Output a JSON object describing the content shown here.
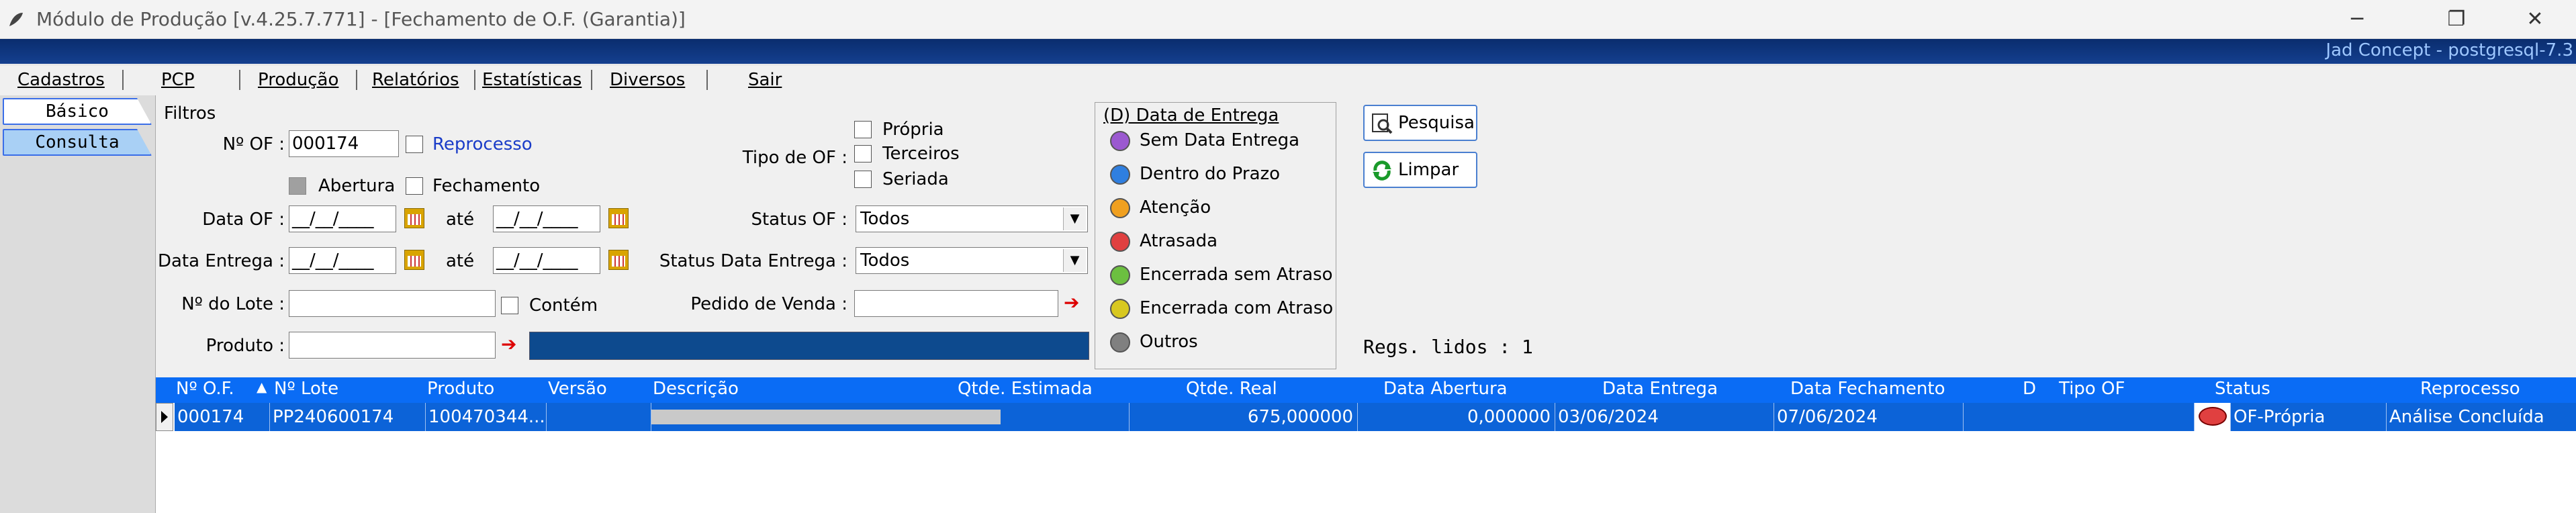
{
  "window": {
    "title": "Módulo de Produção [v.4.25.7.771]  - [Fechamento de O.F. (Garantia)]",
    "connection": "Jad Concept - postgresql-7.3",
    "minimize_icon": "minimize-icon",
    "maximize_icon": "restore-icon",
    "close_icon": "close-icon"
  },
  "menu": [
    "Cadastros",
    "PCP",
    "Produção",
    "Relatórios",
    "Estatísticas",
    "Diversos",
    "Sair"
  ],
  "tabs": {
    "basico": "Básico",
    "consulta": "Consulta"
  },
  "filters": {
    "group_label": "Filtros",
    "num_of_label": "Nº OF :",
    "num_of_value": "000174",
    "reprocesso_label": "Reprocesso",
    "abertura_label": "Abertura",
    "fechamento_label": "Fechamento",
    "data_of_label": "Data OF :",
    "date_mask": "__/__/____",
    "ate_label": "até",
    "data_entrega_label": "Data Entrega :",
    "lote_label": "Nº do Lote :",
    "lote_value": "",
    "contem_label": "Contém",
    "produto_label": "Produto :",
    "produto_value": "",
    "tipo_of_label": "Tipo de OF :",
    "tipo_options": [
      "Própria",
      "Terceiros",
      "Seriada"
    ],
    "status_of_label": "Status OF :",
    "status_of_value": "Todos",
    "status_data_entrega_label": "Status Data Entrega :",
    "status_data_entrega_value": "Todos",
    "pedido_venda_label": "Pedido de Venda :",
    "pedido_venda_value": ""
  },
  "legend": {
    "title": "(D) Data de Entrega",
    "items": [
      {
        "label": "Sem Data Entrega",
        "color": "#9b59d0"
      },
      {
        "label": "Dentro do Prazo",
        "color": "#2f7fe0"
      },
      {
        "label": "Atenção",
        "color": "#f0a020"
      },
      {
        "label": "Atrasada",
        "color": "#e04040"
      },
      {
        "label": "Encerrada sem Atraso",
        "color": "#6cc040"
      },
      {
        "label": "Encerrada com Atraso",
        "color": "#d8c820"
      },
      {
        "label": "Outros",
        "color": "#808080"
      }
    ]
  },
  "buttons": {
    "pesquisa": "Pesquisa",
    "limpar": "Limpar"
  },
  "regs": "Regs. lidos : 1",
  "grid": {
    "columns": [
      "Nº O.F.",
      "Nº Lote",
      "Produto",
      "Versão",
      "Descrição",
      "Qtde. Estimada",
      "Qtde. Real",
      "Data Abertura",
      "Data Entrega",
      "Data Fechamento",
      "D",
      "Tipo OF",
      "Status",
      "Reprocesso"
    ],
    "sort_icon": "sort-ascending-icon",
    "rows": [
      {
        "of": "000174",
        "lote": "PP240600174",
        "produto": "100470344...",
        "versao": "",
        "descricao": "",
        "qtde_estimada": "675,000000",
        "qtde_real": "0,000000",
        "data_abertura": "03/06/2024",
        "data_entrega": "07/06/2024",
        "data_fechamento": "",
        "d_color": "#e04040",
        "tipo_of": "OF-Própria",
        "status": "Análise Concluída",
        "reprocesso": ""
      }
    ]
  }
}
